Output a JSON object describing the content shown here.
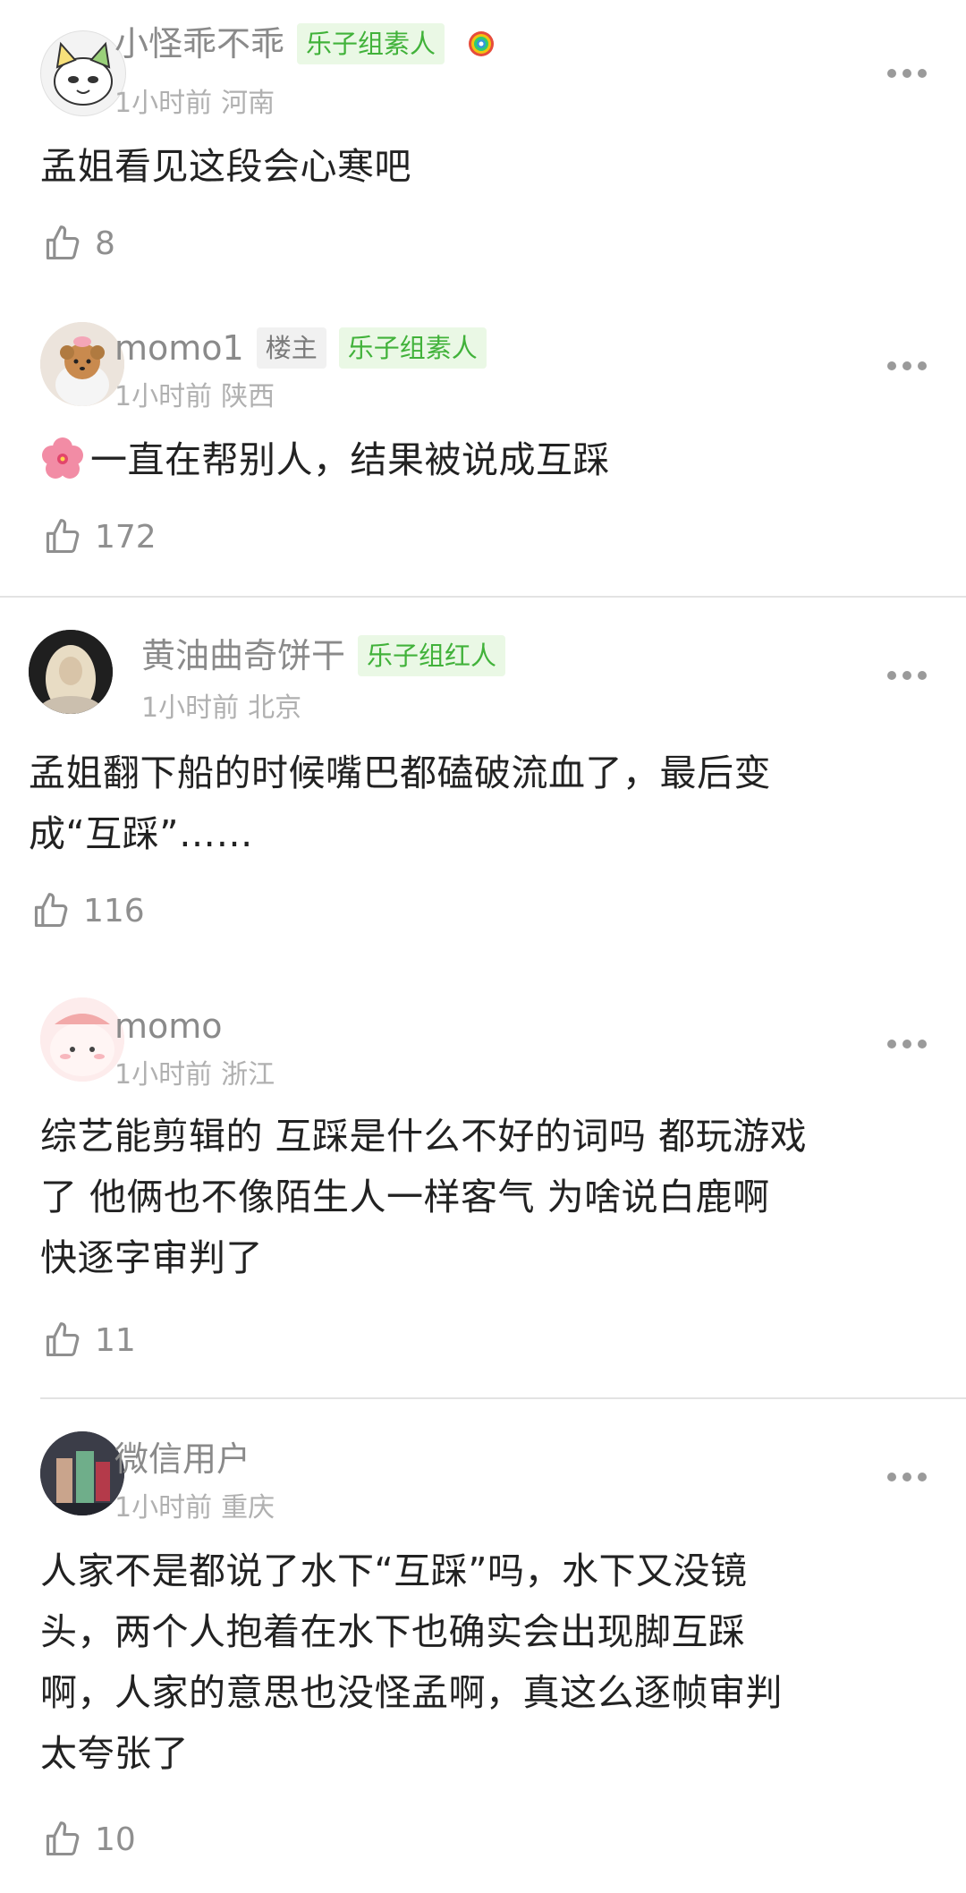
{
  "comments": [
    {
      "username": "小怪乖不乖",
      "badge": "乐子组素人",
      "time": "1小时前",
      "location": "河南",
      "text": "孟姐看见这段会心寒吧",
      "likes": "8"
    },
    {
      "username": "momo1",
      "op_badge": "楼主",
      "badge": "乐子组素人",
      "time": "1小时前",
      "location": "陕西",
      "text": "一直在帮别人，结果被说成互踩",
      "likes": "172"
    },
    {
      "username": "黄油曲奇饼干",
      "badge": "乐子组红人",
      "time": "1小时前",
      "location": "北京",
      "text_lines": [
        "孟姐翻下船的时候嘴巴都磕破流血了，最后变",
        "成“互踩”……"
      ],
      "likes": "116"
    },
    {
      "username": "momo",
      "time": "1小时前",
      "location": "浙江",
      "text_lines": [
        "综艺能剪辑的 互踩是什么不好的词吗 都玩游戏",
        "了 他俩也不像陌生人一样客气 为啥说白鹿啊",
        "快逐字审判了"
      ],
      "likes": "11"
    },
    {
      "username": "微信用户",
      "time": "1小时前",
      "location": "重庆",
      "text_lines": [
        "人家不是都说了水下“互踩”吗，水下又没镜",
        "头，两个人抱着在水下也确实会出现脚互踩",
        "啊，人家的意思也没怪孟啊，真这么逐帧审判",
        "太夸张了"
      ],
      "likes": "10"
    }
  ],
  "colors": {
    "badge_green": "#41b23a",
    "badge_bg": "#eaf8e5",
    "meta_gray": "#b0b0b0",
    "username_gray": "#8a8a8a"
  },
  "icons": [
    "thumbs-up-icon",
    "more-icon",
    "flower-emoji-icon",
    "rainbow-icon"
  ]
}
